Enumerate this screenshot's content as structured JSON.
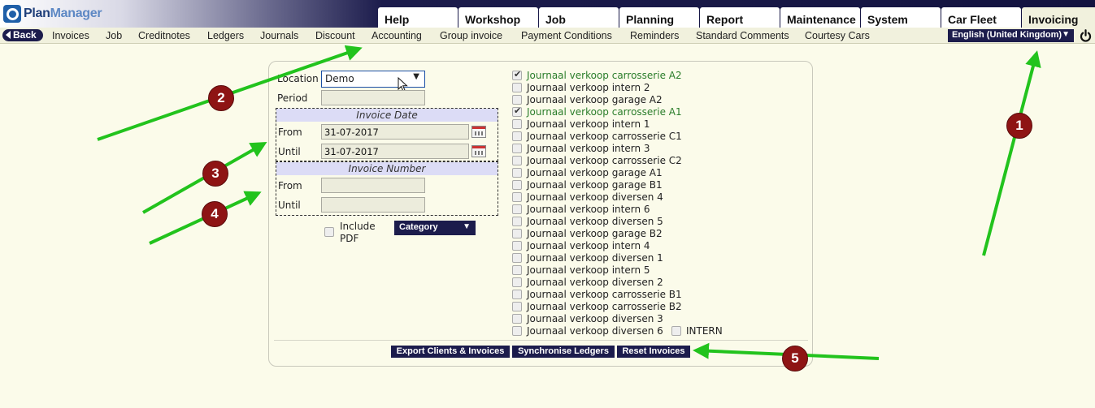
{
  "app": {
    "logo_plan": "Plan",
    "logo_manager": "Manager"
  },
  "tabs": [
    "Help",
    "Workshop",
    "Job",
    "Planning",
    "Report",
    "Maintenance",
    "System",
    "Car Fleet",
    "Invoicing"
  ],
  "active_tab": "Invoicing",
  "menu": {
    "back_label": "Back",
    "items": [
      "Invoices",
      "Job",
      "Creditnotes",
      "Ledgers",
      "Journals",
      "Discount",
      "Accounting",
      "Group invoice",
      "Payment Conditions",
      "Reminders",
      "Standard Comments",
      "Courtesy Cars"
    ],
    "language": "English (United Kingdom)"
  },
  "form": {
    "location_label": "Location",
    "location_value": "Demo",
    "period_label": "Period",
    "period_value": "",
    "invoice_date": {
      "title": "Invoice Date",
      "from_label": "From",
      "from_value": "31-07-2017",
      "until_label": "Until",
      "until_value": "31-07-2017"
    },
    "invoice_number": {
      "title": "Invoice Number",
      "from_label": "From",
      "from_value": "",
      "until_label": "Until",
      "until_value": ""
    },
    "include_pdf_line1": "Include",
    "include_pdf_line2": "PDF",
    "include_pdf_checked": false,
    "category_label": "Category"
  },
  "journals": [
    {
      "label": "Journaal verkoop carrosserie A2",
      "checked": true
    },
    {
      "label": "Journaal verkoop intern 2",
      "checked": false
    },
    {
      "label": "Journaal verkoop garage A2",
      "checked": false
    },
    {
      "label": "Journaal verkoop carrosserie A1",
      "checked": true
    },
    {
      "label": "Journaal verkoop intern 1",
      "checked": false
    },
    {
      "label": "Journaal verkoop carrosserie C1",
      "checked": false
    },
    {
      "label": "Journaal verkoop intern 3",
      "checked": false
    },
    {
      "label": "Journaal verkoop carrosserie C2",
      "checked": false
    },
    {
      "label": "Journaal verkoop garage A1",
      "checked": false
    },
    {
      "label": "Journaal verkoop garage B1",
      "checked": false
    },
    {
      "label": "Journaal verkoop diversen 4",
      "checked": false
    },
    {
      "label": "Journaal verkoop intern 6",
      "checked": false
    },
    {
      "label": "Journaal verkoop diversen 5",
      "checked": false
    },
    {
      "label": "Journaal verkoop garage B2",
      "checked": false
    },
    {
      "label": "Journaal verkoop intern 4",
      "checked": false
    },
    {
      "label": "Journaal verkoop diversen 1",
      "checked": false
    },
    {
      "label": "Journaal verkoop intern 5",
      "checked": false
    },
    {
      "label": "Journaal verkoop diversen 2",
      "checked": false
    },
    {
      "label": "Journaal verkoop carrosserie B1",
      "checked": false
    },
    {
      "label": "Journaal verkoop carrosserie B2",
      "checked": false
    },
    {
      "label": "Journaal verkoop diversen 3",
      "checked": false
    },
    {
      "label": "Journaal verkoop diversen 6",
      "checked": false
    }
  ],
  "intern_label": "INTERN",
  "buttons": {
    "export": "Export Clients & Invoices",
    "sync": "Synchronise Ledgers",
    "reset": "Reset Invoices"
  },
  "annotations": [
    "1",
    "2",
    "3",
    "4",
    "5"
  ],
  "colors": {
    "navy": "#1c1c4c",
    "arrow_green": "#22c31d",
    "badge_red": "#8e1414",
    "checked_text": "#2a7d2a"
  }
}
